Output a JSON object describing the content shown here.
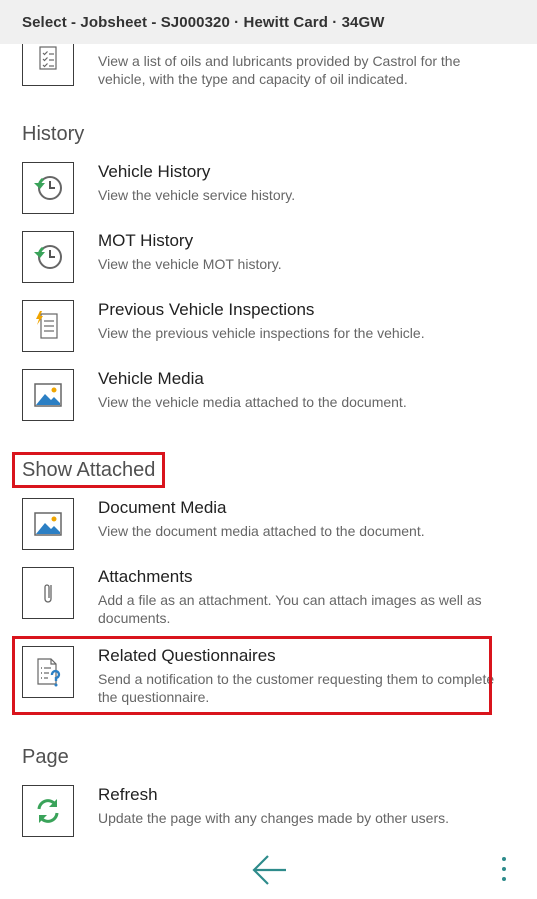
{
  "header": {
    "title": "Select - Jobsheet - SJ000320 · Hewitt Card · 34GW"
  },
  "top_item": {
    "icon": "checklist-icon",
    "description": "View a list of oils and lubricants provided by Castrol for the vehicle, with the type and capacity of oil indicated."
  },
  "sections": {
    "history": {
      "title": "History",
      "items": [
        {
          "title": "Vehicle History",
          "description": "View the vehicle service history.",
          "icon": "history-clock-icon"
        },
        {
          "title": "MOT History",
          "description": "View the vehicle MOT history.",
          "icon": "history-clock-icon"
        },
        {
          "title": "Previous Vehicle Inspections",
          "description": "View the previous vehicle inspections for the vehicle.",
          "icon": "lightning-document-icon"
        },
        {
          "title": "Vehicle Media",
          "description": "View the vehicle media attached to the document.",
          "icon": "image-icon"
        }
      ]
    },
    "show_attached": {
      "title": "Show Attached",
      "items": [
        {
          "title": "Document Media",
          "description": "View the document media attached to the document.",
          "icon": "image-icon"
        },
        {
          "title": "Attachments",
          "description": "Add a file as an attachment. You can attach images as well as documents.",
          "icon": "paperclip-icon"
        },
        {
          "title": "Related Questionnaires",
          "description": "Send a notification to the customer requesting them to complete the questionnaire.",
          "icon": "questionnaire-icon"
        }
      ]
    },
    "page": {
      "title": "Page",
      "items": [
        {
          "title": "Refresh",
          "description": "Update the page with any changes made by other users.",
          "icon": "refresh-icon"
        }
      ]
    }
  },
  "footer": {
    "back_icon": "back-arrow-icon",
    "more_icon": "more-vertical-icon"
  },
  "colors": {
    "highlight": "#d9141c",
    "teal": "#2e8b8b",
    "green": "#3aa35a"
  }
}
